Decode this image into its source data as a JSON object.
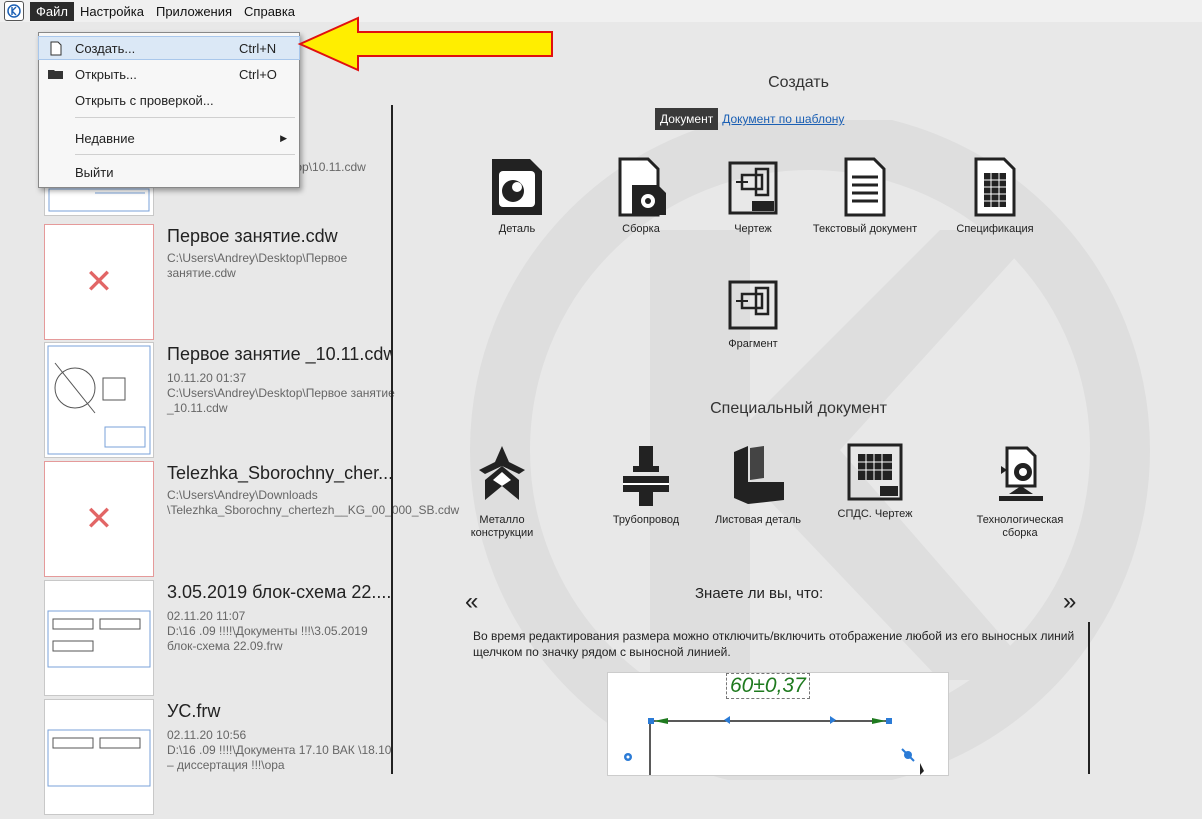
{
  "menubar": {
    "items": [
      "Файл",
      "Настройка",
      "Приложения",
      "Справка"
    ]
  },
  "file_menu": {
    "create_label": "Создать...",
    "create_shortcut": "Ctrl+N",
    "open_label": "Открыть...",
    "open_shortcut": "Ctrl+O",
    "open_check_label": "Открыть с проверкой...",
    "recent_label": "Недавние",
    "exit_label": "Выйти"
  },
  "recent": [
    {
      "title": "",
      "date": "",
      "path": "ktop\\10.11.cdw"
    },
    {
      "title": "Первое занятие.cdw",
      "date": "",
      "path": "C:\\Users\\Andrey\\Desktop\\Первое занятие.cdw"
    },
    {
      "title": "Первое занятие _10.11.cdw",
      "date": "10.11.20 01:37",
      "path": "C:\\Users\\Andrey\\Desktop\\Первое занятие _10.11.cdw"
    },
    {
      "title": "Telezhka_Sborochny_cher...",
      "date": "",
      "path": "C:\\Users\\Andrey\\Downloads \\Telezhka_Sborochny_chertezh__KG_00_000_SB.cdw"
    },
    {
      "title": "3.05.2019 блок-схема 22....",
      "date": "02.11.20 11:07",
      "path": "D:\\16 .09 !!!!\\Документы !!!\\3.05.2019 блок-схема 22.09.frw"
    },
    {
      "title": "УС.frw",
      "date": "02.11.20 10:56",
      "path": "D:\\16 .09 !!!!\\Документа 17.10 ВАК \\18.10 – диссертация !!!\\ора"
    }
  ],
  "create": {
    "title": "Создать",
    "tab_document": "Документ",
    "tab_template": "Документ по шаблону",
    "tiles": [
      "Деталь",
      "Сборка",
      "Чертеж",
      "Текстовый документ",
      "Спецификация",
      "Фрагмент"
    ]
  },
  "special": {
    "title": "Специальный документ",
    "tiles": [
      "Металло конструкции",
      "Трубопровод",
      "Листовая деталь",
      "СПДС. Чертеж",
      "Технологическая сборка"
    ]
  },
  "tips": {
    "title": "Знаете ли вы, что:",
    "prev": "«",
    "next": "»",
    "text": "Во время редактирования размера можно отключить/включить отображение любой из его выносных линий щелчком по значку рядом с выносной линией.",
    "dimension": "60±0,37"
  },
  "colors": {
    "arrow_fill": "#ffee00",
    "arrow_stroke": "#e01010",
    "missing_x": "#e26666",
    "link": "#1a5fb4"
  }
}
